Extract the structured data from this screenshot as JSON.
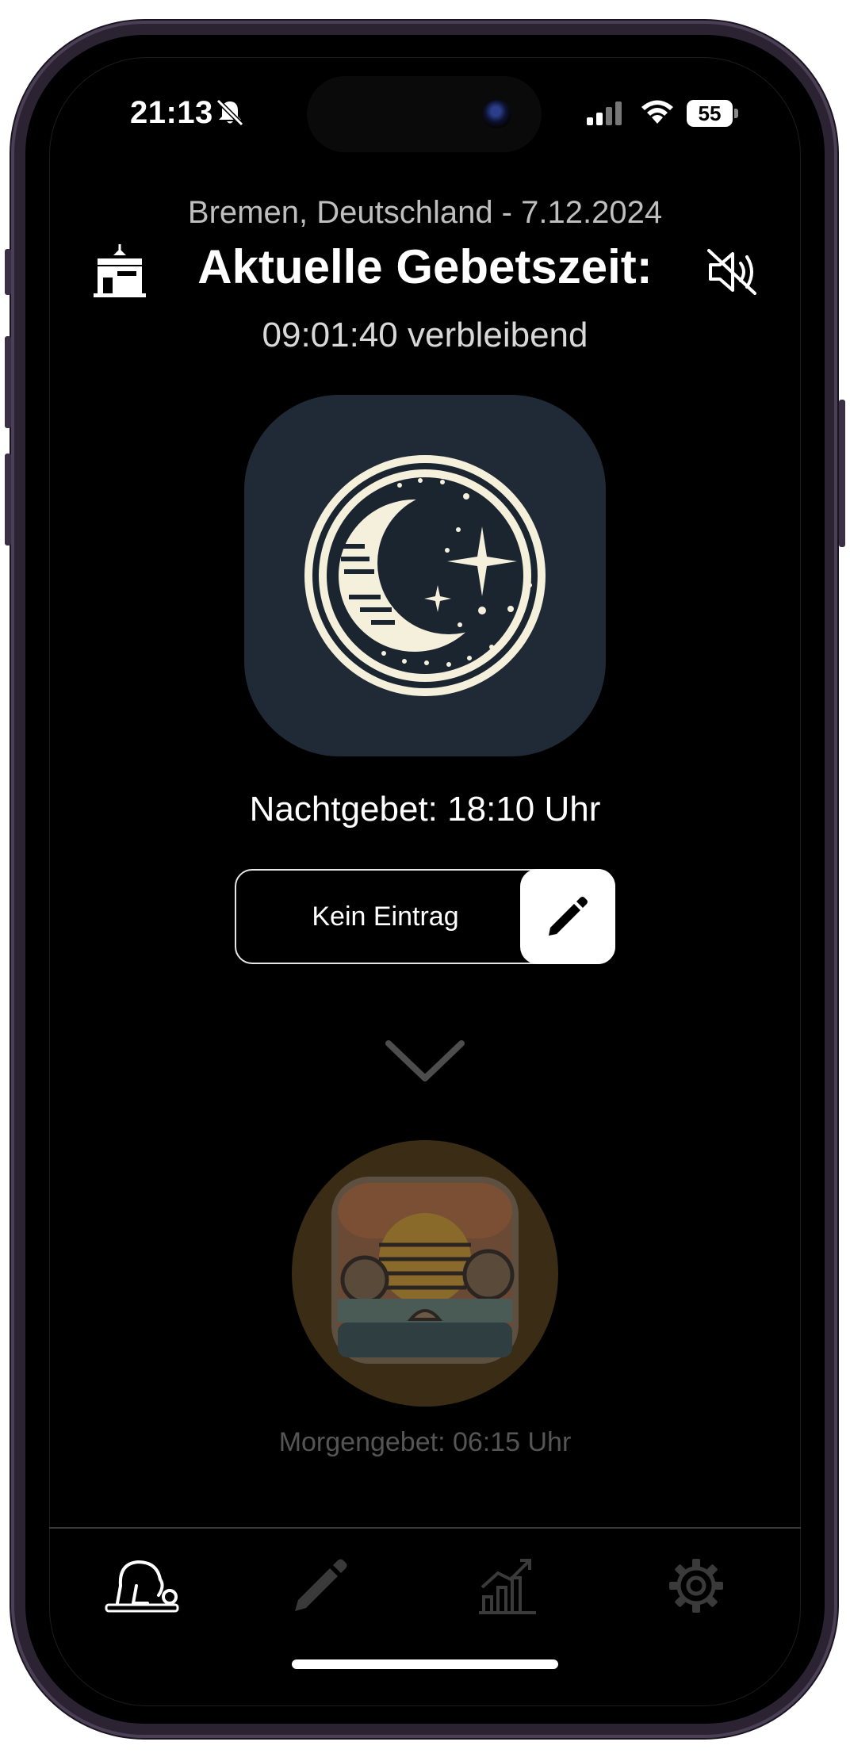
{
  "status_bar": {
    "time": "21:13",
    "battery": "55",
    "icons": [
      "bell-slash-icon",
      "cellular-signal-icon",
      "wifi-icon",
      "battery-icon"
    ]
  },
  "header": {
    "location_date": "Bremen, Deutschland - 7.12.2024",
    "title": "Aktuelle Gebetszeit:",
    "remaining": "09:01:40 verbleibend",
    "left_icon": "mosque-icon",
    "right_icon": "speaker-muted-icon"
  },
  "current_prayer": {
    "image_icon": "moon-stars-icon",
    "label": "Nachtgebet: 18:10 Uhr",
    "tile_color": "#1f2a36"
  },
  "entry": {
    "label": "Kein Eintrag",
    "edit_icon": "pencil-icon"
  },
  "next_prayer": {
    "chevron_icon": "chevron-down-icon",
    "image_icon": "sunrise-icon",
    "label": "Morgengebet: 06:15 Uhr"
  },
  "tab_bar": {
    "items": [
      {
        "name": "prayer",
        "icon": "praying-person-icon",
        "active": true
      },
      {
        "name": "edit",
        "icon": "pencil-icon",
        "active": false
      },
      {
        "name": "stats",
        "icon": "chart-icon",
        "active": false
      },
      {
        "name": "settings",
        "icon": "gear-icon",
        "active": false
      }
    ]
  },
  "colors": {
    "background": "#000000",
    "text": "#ffffff",
    "muted_text": "#555555",
    "inactive_icon": "#3a3a3a"
  }
}
